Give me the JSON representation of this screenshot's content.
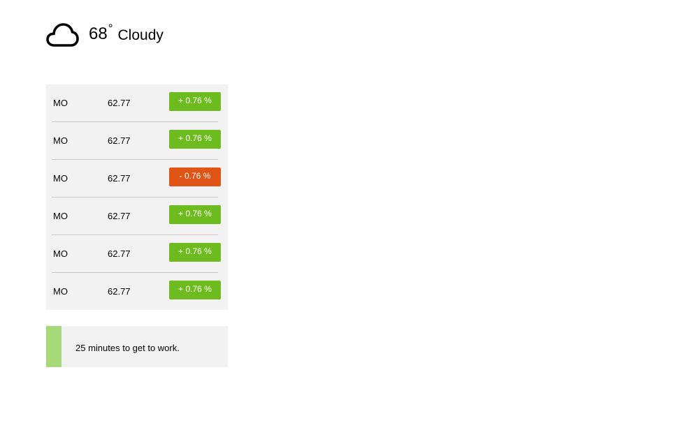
{
  "weather": {
    "icon": "cloud-icon",
    "temperature": "68",
    "degree_symbol": "°",
    "condition": "Cloudy"
  },
  "stocks": [
    {
      "symbol": "MO",
      "price": "62.77",
      "change": "+ 0.76 %",
      "direction": "up"
    },
    {
      "symbol": "MO",
      "price": "62.77",
      "change": "+ 0.76 %",
      "direction": "up"
    },
    {
      "symbol": "MO",
      "price": "62.77",
      "change": "- 0.76 %",
      "direction": "down"
    },
    {
      "symbol": "MO",
      "price": "62.77",
      "change": "+ 0.76 %",
      "direction": "up"
    },
    {
      "symbol": "MO",
      "price": "62.77",
      "change": "+ 0.76 %",
      "direction": "up"
    },
    {
      "symbol": "MO",
      "price": "62.77",
      "change": "+ 0.76 %",
      "direction": "up"
    }
  ],
  "commute": {
    "message": "25 minutes to get to work."
  },
  "colors": {
    "up": "#6dbb1e",
    "down": "#e05416",
    "commute_bar": "#a5d97a",
    "panel_bg": "#f2f2f2"
  }
}
